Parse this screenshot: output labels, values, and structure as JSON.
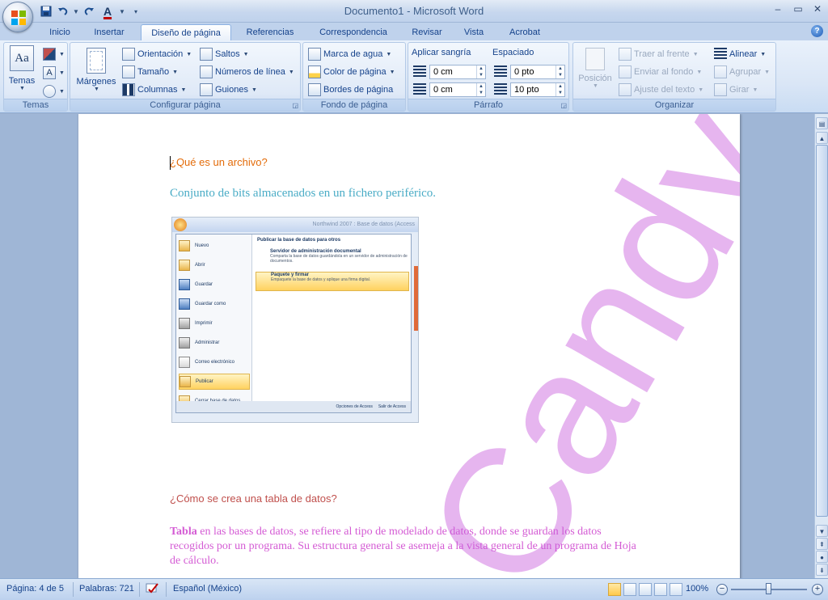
{
  "window": {
    "title": "Documento1 - Microsoft Word",
    "controls": {
      "minimize": "–",
      "maximize": "▭",
      "close": "✕"
    }
  },
  "quick_access": {
    "save_icon": "save-icon",
    "undo_icon": "undo-icon",
    "redo_icon": "redo-icon",
    "font_color_icon": "font-color-icon",
    "font_color_label": "A"
  },
  "tabs": [
    {
      "label": "Inicio"
    },
    {
      "label": "Insertar"
    },
    {
      "label": "Diseño de página",
      "active": true
    },
    {
      "label": "Referencias"
    },
    {
      "label": "Correspondencia"
    },
    {
      "label": "Revisar"
    },
    {
      "label": "Vista"
    },
    {
      "label": "Acrobat"
    }
  ],
  "ribbon": {
    "temas": {
      "label": "Temas",
      "themes_button": "Temas",
      "theme_glyph": "Aa"
    },
    "configurar": {
      "label": "Configurar página",
      "margenes": "Márgenes",
      "orientacion": "Orientación",
      "tamano": "Tamaño",
      "columnas": "Columnas",
      "saltos": "Saltos",
      "numeros_linea": "Números de línea",
      "guiones": "Guiones"
    },
    "fondo": {
      "label": "Fondo de página",
      "marca_agua": "Marca de agua",
      "color_pagina": "Color de página",
      "bordes_pagina": "Bordes de página"
    },
    "parrafo": {
      "label": "Párrafo",
      "aplicar_sangria": "Aplicar sangría",
      "espaciado": "Espaciado",
      "sangria_izq": "0 cm",
      "sangria_der": "0 cm",
      "espacio_antes": "0 pto",
      "espacio_despues": "10 pto"
    },
    "organizar": {
      "label": "Organizar",
      "posicion": "Posición",
      "traer_frente": "Traer al frente",
      "enviar_fondo": "Enviar al fondo",
      "ajuste_texto": "Ajuste del texto",
      "alinear": "Alinear",
      "agrupar": "Agrupar",
      "girar": "Girar"
    }
  },
  "document": {
    "heading1": "¿Qué es un archivo?",
    "answer1": "Conjunto de bits almacenados en un fichero periférico.",
    "heading2": "¿Cómo se crea una tabla de datos?",
    "para2_bold": "Tabla",
    "para2_rest": " en las bases de datos, se refiere al tipo de modelado de datos, donde se guardan los datos recogidos por un programa. Su estructura general se asemeja a la vista general de un programa de Hoja de cálculo.",
    "watermark": "Candy",
    "embedded_screenshot": {
      "title": "Northwind 2007 : Base de datos (Access",
      "left_menu": [
        "Nuevo",
        "Abrir",
        "Guardar",
        "Guardar como",
        "Imprimir",
        "Administrar",
        "Correo electrónico",
        "Publicar",
        "Cerrar base de datos"
      ],
      "right_title": "Publicar la base de datos para otros",
      "right_items": [
        {
          "title": "Servidor de administración documental",
          "desc": "Comparta la base de datos guardándola en un servidor de administración de documentos."
        },
        {
          "title": "Paquete y firmar",
          "desc": "Empaquete la base de datos y aplique una firma digital."
        }
      ],
      "bottom_buttons": [
        "Opciones de Access",
        "Salir de Access"
      ]
    }
  },
  "statusbar": {
    "page": "Página: 4 de 5",
    "words": "Palabras: 721",
    "language": "Español (México)",
    "zoom": "100%",
    "zoom_level_percent": 100
  },
  "colors": {
    "heading1": "#e36c0a",
    "answer1": "#4aacc6",
    "heading2": "#c0504d",
    "para2": "#d45bd4",
    "watermark": "#c85adc"
  }
}
